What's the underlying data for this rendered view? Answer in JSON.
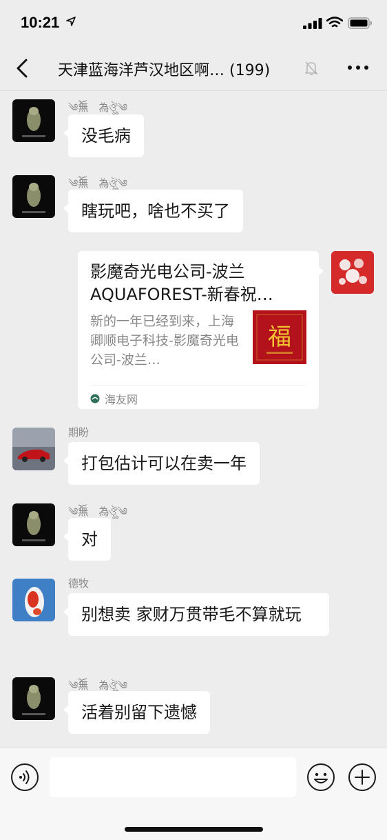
{
  "status": {
    "time": "10:21"
  },
  "header": {
    "title": "天津蓝海洋芦汉地区啊… (199)"
  },
  "messages": [
    {
      "sender": "༄ོ無　為ঔৣ༄",
      "text": "没毛病"
    },
    {
      "sender": "༄ོ無　為ঔৣ༄",
      "text": "瞎玩吧，啥也不买了"
    },
    {
      "sender": "期盼",
      "text": "打包估计可以在卖一年"
    },
    {
      "sender": "༄ོ無　為ঔৣ༄",
      "text": "对"
    },
    {
      "sender": "德牧",
      "text": "别想卖  家财万贯带毛不算就玩"
    },
    {
      "sender": "༄ོ無　為ঔৣ༄",
      "text": "活着别留下遗憾"
    }
  ],
  "link_card": {
    "title": "影魔奇光电公司-波兰AQUAFOREST-新春祝…",
    "description": "新的一年已经到来，上海卿顺电子科技-影魔奇光电公司-波兰…",
    "source": "海友网",
    "thumb_text": "福"
  },
  "colors": {
    "background": "#ededed",
    "bubble": "#ffffff",
    "muted_text": "#888888"
  }
}
